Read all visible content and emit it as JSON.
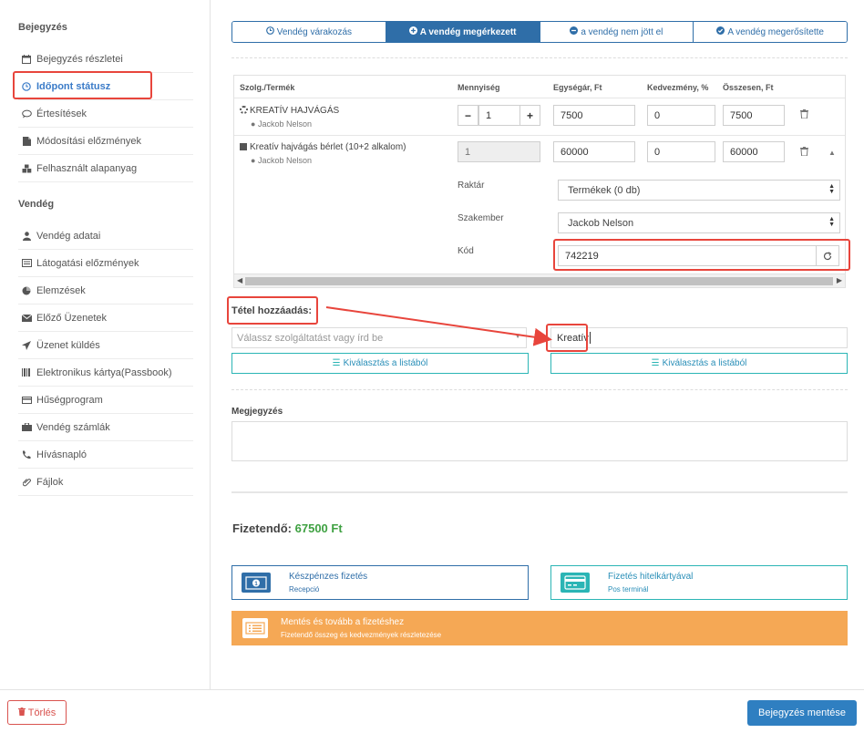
{
  "sidebar": {
    "section1": "Bejegyzés",
    "items1": [
      {
        "label": "Bejegyzés részletei",
        "icon": "calendar-icon"
      },
      {
        "label": "Időpont státusz",
        "icon": "clock-icon",
        "active": true
      },
      {
        "label": "Értesítések",
        "icon": "chat-icon"
      },
      {
        "label": "Módosítási előzmények",
        "icon": "file-icon"
      },
      {
        "label": "Felhasznált alapanyag",
        "icon": "cubes-icon"
      }
    ],
    "section2": "Vendég",
    "items2": [
      {
        "label": "Vendég adatai",
        "icon": "user-icon"
      },
      {
        "label": "Látogatási előzmények",
        "icon": "list-icon"
      },
      {
        "label": "Elemzések",
        "icon": "pie-chart-icon"
      },
      {
        "label": "Előző Üzenetek",
        "icon": "envelope-icon"
      },
      {
        "label": "Üzenet küldés",
        "icon": "send-icon"
      },
      {
        "label": "Elektronikus kártya(Passbook)",
        "icon": "barcode-icon"
      },
      {
        "label": "Hűségprogram",
        "icon": "card-icon"
      },
      {
        "label": "Vendég számlák",
        "icon": "briefcase-icon"
      },
      {
        "label": "Hívásnapló",
        "icon": "phone-icon"
      },
      {
        "label": "Fájlok",
        "icon": "paperclip-icon"
      }
    ]
  },
  "status_tabs": [
    {
      "label": "Vendég várakozás",
      "icon": "clock-icon"
    },
    {
      "label": "A vendég megérkezett",
      "icon": "plus-circle-icon",
      "active": true
    },
    {
      "label": "a vendég nem jött el",
      "icon": "minus-circle-icon"
    },
    {
      "label": "A vendég megerősítette",
      "icon": "check-circle-icon"
    }
  ],
  "table": {
    "headers": {
      "service": "Szolg./Termék",
      "qty": "Mennyiség",
      "unit_price": "Egységár, Ft",
      "discount": "Kedvezmény, %",
      "total": "Összesen, Ft"
    },
    "rows": [
      {
        "name": "KREATÍV HAJVÁGÁS",
        "staff": "Jackob Nelson",
        "qty": "1",
        "unit_price": "7500",
        "discount": "0",
        "total": "7500"
      },
      {
        "name": "Kreatív hajvágás bérlet (10+2 alkalom)",
        "staff": "Jackob Nelson",
        "qty": "1",
        "unit_price": "60000",
        "discount": "0",
        "total": "60000"
      }
    ],
    "details": {
      "warehouse_label": "Raktár",
      "warehouse_value": "Termékek (0 db)",
      "specialist_label": "Szakember",
      "specialist_value": "Jackob Nelson",
      "code_label": "Kód",
      "code_value": "742219"
    }
  },
  "add_item": {
    "title": "Tétel hozzáadás:",
    "select_placeholder": "Válassz szolgáltatást vagy írd be",
    "search_value": "Kreatív",
    "choose_left": "Kiválasztás a listából",
    "choose_right": "Kiválasztás a listából"
  },
  "notes": {
    "label": "Megjegyzés"
  },
  "due": {
    "label": "Fizetendő:",
    "amount": "67500 Ft"
  },
  "payments": {
    "cash_title": "Készpénzes fizetés",
    "cash_sub": "Recepció",
    "card_title": "Fizetés hitelkártyával",
    "card_sub": "Pos terminál",
    "save_next_title": "Mentés és tovább a fizetéshez",
    "save_next_sub": "Fizetendő összeg és kedvezmények részletezése"
  },
  "footer": {
    "delete": "Törlés",
    "save": "Bejegyzés mentése"
  },
  "colors": {
    "primary": "#2f6ea8",
    "highlight": "#e8453c",
    "teal": "#2bb5b5",
    "orange": "#f5a855",
    "green": "#3fa142"
  }
}
